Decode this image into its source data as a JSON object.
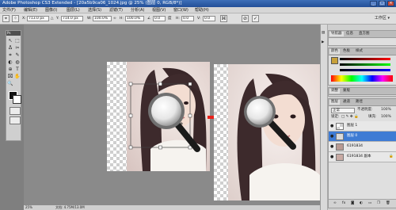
{
  "window": {
    "title": "Adobe Photoshop CS3 Extended - [20a5b9ca06_1024.jpg @ 25% (图层 0, RGB/8*)]",
    "buttons": [
      "_",
      "□",
      "×"
    ]
  },
  "menu": [
    "文件(F)",
    "编辑(E)",
    "图像(I)",
    "图层(L)",
    "选择(S)",
    "滤镜(T)",
    "分析(A)",
    "视图(V)",
    "窗口(W)",
    "帮助(H)"
  ],
  "options": {
    "x_label": "X:",
    "x_value": "713.0 px",
    "y_label": "Y:",
    "y_value": "714.0 px",
    "w_label": "W:",
    "w_value": "100.0%",
    "h_label": "H:",
    "h_value": "100.0%",
    "rotate_value": "0.0",
    "skew_h_label": "H:",
    "skew_h_value": "0.0",
    "skew_v_label": "V:",
    "skew_v_value": "0.0",
    "cancel_icon": "⊘",
    "commit_icon": "✓",
    "workspace_label": "工作区 ▾"
  },
  "toolbox": {
    "header": "Ps",
    "tools": [
      "↖",
      "⬚",
      "ᐃ",
      "✂",
      "⌗",
      "✎",
      "◐",
      "◍",
      "⊕",
      "T",
      "⌧",
      "✋",
      "🔍",
      "■"
    ]
  },
  "status": {
    "zoom": "25%",
    "doc_info": "文档: 4.75M/13.0M"
  },
  "panels": {
    "nav_tabs": [
      "导航器",
      "信息",
      "直方图"
    ],
    "color_tabs": [
      "颜色",
      "色板",
      "样式"
    ],
    "adjust_tabs": [
      "调整",
      "蒙版"
    ],
    "layers_tabs": [
      "图层",
      "通道",
      "路径"
    ],
    "blend_mode": "正常",
    "opacity_label": "不透明度:",
    "opacity_value": "100%",
    "lock_label": "锁定:",
    "fill_label": "填充:",
    "fill_value": "100%",
    "layers": [
      {
        "name": "图层 1",
        "selected": false
      },
      {
        "name": "图层 0",
        "selected": true
      },
      {
        "name": "6191834",
        "selected": false
      },
      {
        "name": "6191834 副本",
        "selected": false
      }
    ]
  },
  "colors": {
    "selection": "#3e7bd4",
    "arrow": "#e8211a"
  }
}
